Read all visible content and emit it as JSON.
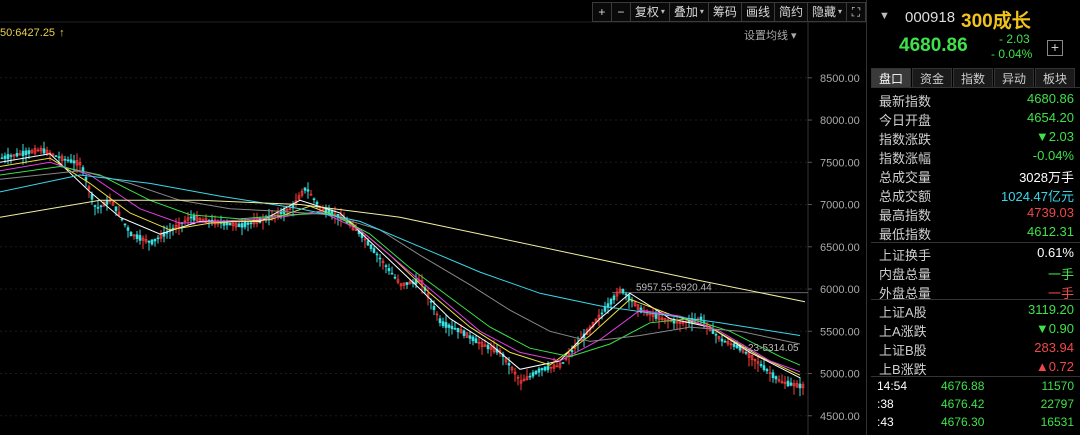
{
  "toolbar": [
    {
      "label": "+",
      "name": "zoom-in-button",
      "square": true
    },
    {
      "label": "−",
      "name": "zoom-out-button",
      "square": true
    },
    {
      "label": "复权",
      "name": "adjust-dropdown",
      "dropdown": true
    },
    {
      "label": "叠加",
      "name": "overlay-dropdown",
      "dropdown": true
    },
    {
      "label": "筹码",
      "name": "chips-button"
    },
    {
      "label": "画线",
      "name": "draw-line-button"
    },
    {
      "label": "简约",
      "name": "simple-mode-button"
    },
    {
      "label": "隐藏",
      "name": "hide-dropdown",
      "dropdown": true
    },
    {
      "label": "⛶",
      "name": "fullscreen-icon",
      "square": true
    }
  ],
  "ma_readout": {
    "text": "50:6427.25",
    "arrow": "↑"
  },
  "ma_setting": "设置均线 ▾",
  "annotations": {
    "high_label": "5957.55-5920.44",
    "mid_label": "23-5314.05"
  },
  "chart_data": {
    "type": "candlestick",
    "ylim": [
      4450,
      8900
    ],
    "yticks": [
      4500,
      5000,
      5500,
      6000,
      6500,
      7000,
      7500,
      8000,
      8500
    ],
    "ytick_labels": [
      "4500.00",
      "5000.00",
      "5500.00",
      "6000.00",
      "6500.00",
      "7000.00",
      "7500.00",
      "8000.00",
      "8500.00"
    ],
    "price_path": [
      [
        0,
        7550
      ],
      [
        20,
        7600
      ],
      [
        40,
        7650
      ],
      [
        60,
        7550
      ],
      [
        80,
        7480
      ],
      [
        95,
        6950
      ],
      [
        110,
        7050
      ],
      [
        130,
        6650
      ],
      [
        150,
        6550
      ],
      [
        170,
        6700
      ],
      [
        190,
        6850
      ],
      [
        210,
        6800
      ],
      [
        240,
        6750
      ],
      [
        270,
        6850
      ],
      [
        290,
        6950
      ],
      [
        305,
        7200
      ],
      [
        320,
        6950
      ],
      [
        340,
        6850
      ],
      [
        360,
        6650
      ],
      [
        380,
        6350
      ],
      [
        400,
        6050
      ],
      [
        420,
        6100
      ],
      [
        440,
        5600
      ],
      [
        460,
        5500
      ],
      [
        480,
        5350
      ],
      [
        500,
        5250
      ],
      [
        520,
        4900
      ],
      [
        540,
        5050
      ],
      [
        560,
        5100
      ],
      [
        580,
        5400
      ],
      [
        600,
        5700
      ],
      [
        620,
        6000
      ],
      [
        640,
        5750
      ],
      [
        660,
        5650
      ],
      [
        680,
        5600
      ],
      [
        700,
        5650
      ],
      [
        720,
        5400
      ],
      [
        740,
        5300
      ],
      [
        760,
        5100
      ],
      [
        780,
        4900
      ],
      [
        800,
        4850
      ]
    ],
    "ma_lines": [
      {
        "color": "#ffffff",
        "values": [
          [
            0,
            7500
          ],
          [
            50,
            7600
          ],
          [
            90,
            7150
          ],
          [
            120,
            6850
          ],
          [
            160,
            6650
          ],
          [
            200,
            6800
          ],
          [
            260,
            6800
          ],
          [
            300,
            7050
          ],
          [
            340,
            6900
          ],
          [
            380,
            6450
          ],
          [
            420,
            6000
          ],
          [
            450,
            5650
          ],
          [
            490,
            5350
          ],
          [
            520,
            5050
          ],
          [
            560,
            5150
          ],
          [
            600,
            5650
          ],
          [
            630,
            5950
          ],
          [
            670,
            5650
          ],
          [
            710,
            5550
          ],
          [
            750,
            5250
          ],
          [
            800,
            4950
          ]
        ]
      },
      {
        "color": "#f0e040",
        "values": [
          [
            0,
            7450
          ],
          [
            50,
            7550
          ],
          [
            90,
            7250
          ],
          [
            130,
            6900
          ],
          [
            170,
            6700
          ],
          [
            210,
            6780
          ],
          [
            270,
            6820
          ],
          [
            310,
            6980
          ],
          [
            350,
            6800
          ],
          [
            390,
            6400
          ],
          [
            430,
            5950
          ],
          [
            470,
            5550
          ],
          [
            510,
            5250
          ],
          [
            550,
            5100
          ],
          [
            590,
            5450
          ],
          [
            630,
            5880
          ],
          [
            670,
            5700
          ],
          [
            710,
            5550
          ],
          [
            760,
            5200
          ],
          [
            800,
            4980
          ]
        ]
      },
      {
        "color": "#e040e0",
        "values": [
          [
            0,
            7400
          ],
          [
            50,
            7500
          ],
          [
            90,
            7350
          ],
          [
            140,
            6950
          ],
          [
            180,
            6780
          ],
          [
            220,
            6800
          ],
          [
            280,
            6850
          ],
          [
            320,
            6920
          ],
          [
            360,
            6700
          ],
          [
            400,
            6300
          ],
          [
            440,
            5900
          ],
          [
            480,
            5500
          ],
          [
            520,
            5250
          ],
          [
            560,
            5150
          ],
          [
            600,
            5400
          ],
          [
            640,
            5750
          ],
          [
            680,
            5680
          ],
          [
            720,
            5500
          ],
          [
            770,
            5150
          ],
          [
            800,
            5020
          ]
        ]
      },
      {
        "color": "#3ae04a",
        "values": [
          [
            0,
            7350
          ],
          [
            60,
            7450
          ],
          [
            100,
            7350
          ],
          [
            150,
            7050
          ],
          [
            190,
            6880
          ],
          [
            240,
            6830
          ],
          [
            290,
            6880
          ],
          [
            330,
            6900
          ],
          [
            370,
            6650
          ],
          [
            410,
            6250
          ],
          [
            450,
            5900
          ],
          [
            490,
            5550
          ],
          [
            530,
            5300
          ],
          [
            570,
            5200
          ],
          [
            610,
            5350
          ],
          [
            650,
            5600
          ],
          [
            690,
            5650
          ],
          [
            730,
            5500
          ],
          [
            780,
            5200
          ],
          [
            800,
            5100
          ]
        ]
      },
      {
        "color": "#888888",
        "values": [
          [
            0,
            7300
          ],
          [
            80,
            7400
          ],
          [
            130,
            7250
          ],
          [
            180,
            7050
          ],
          [
            230,
            6950
          ],
          [
            280,
            6920
          ],
          [
            330,
            6880
          ],
          [
            380,
            6700
          ],
          [
            420,
            6400
          ],
          [
            470,
            6050
          ],
          [
            510,
            5750
          ],
          [
            550,
            5500
          ],
          [
            590,
            5380
          ],
          [
            640,
            5450
          ],
          [
            690,
            5550
          ],
          [
            740,
            5500
          ],
          [
            800,
            5350
          ]
        ]
      },
      {
        "color": "#3ad8ea",
        "values": [
          [
            0,
            7150
          ],
          [
            80,
            7350
          ],
          [
            150,
            7250
          ],
          [
            220,
            7100
          ],
          [
            300,
            6950
          ],
          [
            360,
            6800
          ],
          [
            420,
            6500
          ],
          [
            480,
            6200
          ],
          [
            540,
            5950
          ],
          [
            600,
            5800
          ],
          [
            660,
            5700
          ],
          [
            720,
            5600
          ],
          [
            800,
            5450
          ]
        ]
      },
      {
        "color": "#f0f0a0",
        "values": [
          [
            0,
            6850
          ],
          [
            100,
            7050
          ],
          [
            200,
            7050
          ],
          [
            300,
            7000
          ],
          [
            400,
            6850
          ],
          [
            500,
            6600
          ],
          [
            600,
            6350
          ],
          [
            700,
            6100
          ],
          [
            805,
            5850
          ]
        ]
      }
    ],
    "hlines": [
      {
        "y": 5957.55,
        "color": "#666"
      }
    ]
  },
  "panel": {
    "symbol_arrow": "▼",
    "code": "000918",
    "name": "300成长",
    "price": "4680.86",
    "change": "- 2.03",
    "change_pct": "- 0.04%",
    "add_label": "+",
    "tabs": [
      "盘口",
      "资金",
      "指数",
      "异动",
      "板块"
    ],
    "section1": [
      {
        "label": "最新指数",
        "value": "4680.86",
        "cls": "green"
      },
      {
        "label": "今日开盘",
        "value": "4654.20",
        "cls": "green"
      },
      {
        "label": "指数涨跌",
        "value": "▼2.03",
        "cls": "green"
      },
      {
        "label": "指数涨幅",
        "value": "-0.04%",
        "cls": "green"
      },
      {
        "label": "总成交量",
        "value": "3028万手",
        "cls": "white"
      },
      {
        "label": "总成交额",
        "value": "1024.47亿元",
        "cls": "cyan"
      },
      {
        "label": "最高指数",
        "value": "4739.03",
        "cls": "red"
      },
      {
        "label": "最低指数",
        "value": "4612.31",
        "cls": "green"
      }
    ],
    "section2": [
      {
        "label": "上证换手",
        "value": "0.61%",
        "cls": "white"
      },
      {
        "label": "内盘总量",
        "value": "一手",
        "cls": "green"
      },
      {
        "label": "外盘总量",
        "value": "一手",
        "cls": "red"
      }
    ],
    "section3": [
      {
        "label": "上证A股",
        "value": "3119.20",
        "cls": "green"
      },
      {
        "label": "上A涨跌",
        "value": "▼0.90",
        "cls": "green"
      },
      {
        "label": "上证B股",
        "value": "283.94",
        "cls": "red"
      },
      {
        "label": "上B涨跌",
        "value": "▲0.72",
        "cls": "red"
      }
    ],
    "ticks": [
      {
        "time": "14:54",
        "price": "4676.88",
        "vol": "11570"
      },
      {
        "time": ":38",
        "price": "4676.42",
        "vol": "22797"
      },
      {
        "time": ":43",
        "price": "4676.30",
        "vol": "16531"
      }
    ]
  }
}
